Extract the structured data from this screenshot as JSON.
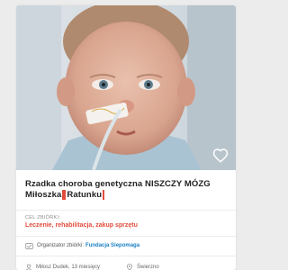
{
  "card": {
    "title_line1": "Rzadka choroba genetyczna NISZCZY MÓZG",
    "title_line2_a": "Miłoszka",
    "title_line2_b": "Ratunku",
    "goal_label": "CEL ZBIÓRKI:",
    "goal_text": "Leczenie, rehabilitacja, zakup sprzętu",
    "organizer_label": "Organizator zbiórki:",
    "organizer_name": "Fundacja Siepomaga",
    "author": "Miłosz Dudek, 13 miesięcy",
    "location": "Świerzno"
  },
  "icons": [
    "heart-icon",
    "fundraiser-icon",
    "person-icon",
    "location-pin-icon"
  ],
  "colors": {
    "accent": "#e34b3a",
    "link": "#1a7fc4",
    "background": "#ececec"
  }
}
